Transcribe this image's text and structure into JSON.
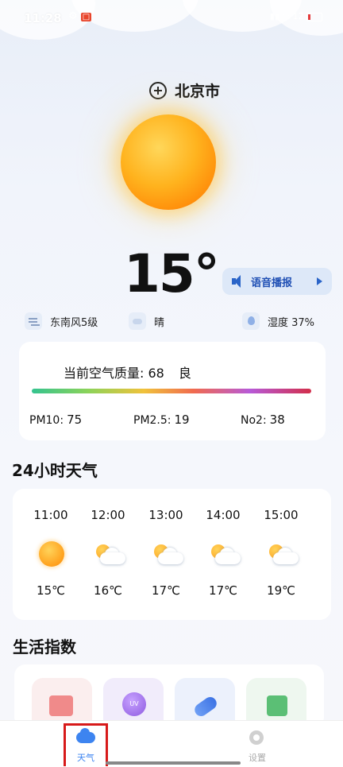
{
  "status_bar": {
    "time": "11:28",
    "battery": "12"
  },
  "header": {
    "city": "北京市"
  },
  "current": {
    "temperature": "15°",
    "voice_button": "语音播报",
    "wind": "东南风5级",
    "condition": "晴",
    "humidity": "湿度 37%"
  },
  "air_quality": {
    "label": "当前空气质量: 68",
    "level": "良",
    "pm10_label": "PM10:",
    "pm10": "75",
    "pm25_label": "PM2.5:",
    "pm25": "19",
    "no2_label": "No2:",
    "no2": "38",
    "gradient_colors": [
      "#34c38f",
      "#8bd35a",
      "#f0c23b",
      "#f06a4f",
      "#b75ad8",
      "#d22e4a"
    ]
  },
  "hourly": {
    "title": "24小时天气",
    "items": [
      {
        "hour": "11:00",
        "icon": "sun-icon",
        "temp": "15℃"
      },
      {
        "hour": "12:00",
        "icon": "partly-cloudy-icon",
        "temp": "16℃"
      },
      {
        "hour": "13:00",
        "icon": "partly-cloudy-icon",
        "temp": "17℃"
      },
      {
        "hour": "14:00",
        "icon": "partly-cloudy-icon",
        "temp": "17℃"
      },
      {
        "hour": "15:00",
        "icon": "partly-cloudy-icon",
        "temp": "19℃"
      }
    ]
  },
  "life": {
    "title": "生活指数",
    "tiles": [
      "clothing-icon",
      "uv-icon",
      "medicine-icon",
      "first-aid-icon"
    ],
    "uv_text": "UV"
  },
  "tabbar": {
    "weather": "天气",
    "settings": "设置",
    "active_color": "#3d84f0"
  }
}
